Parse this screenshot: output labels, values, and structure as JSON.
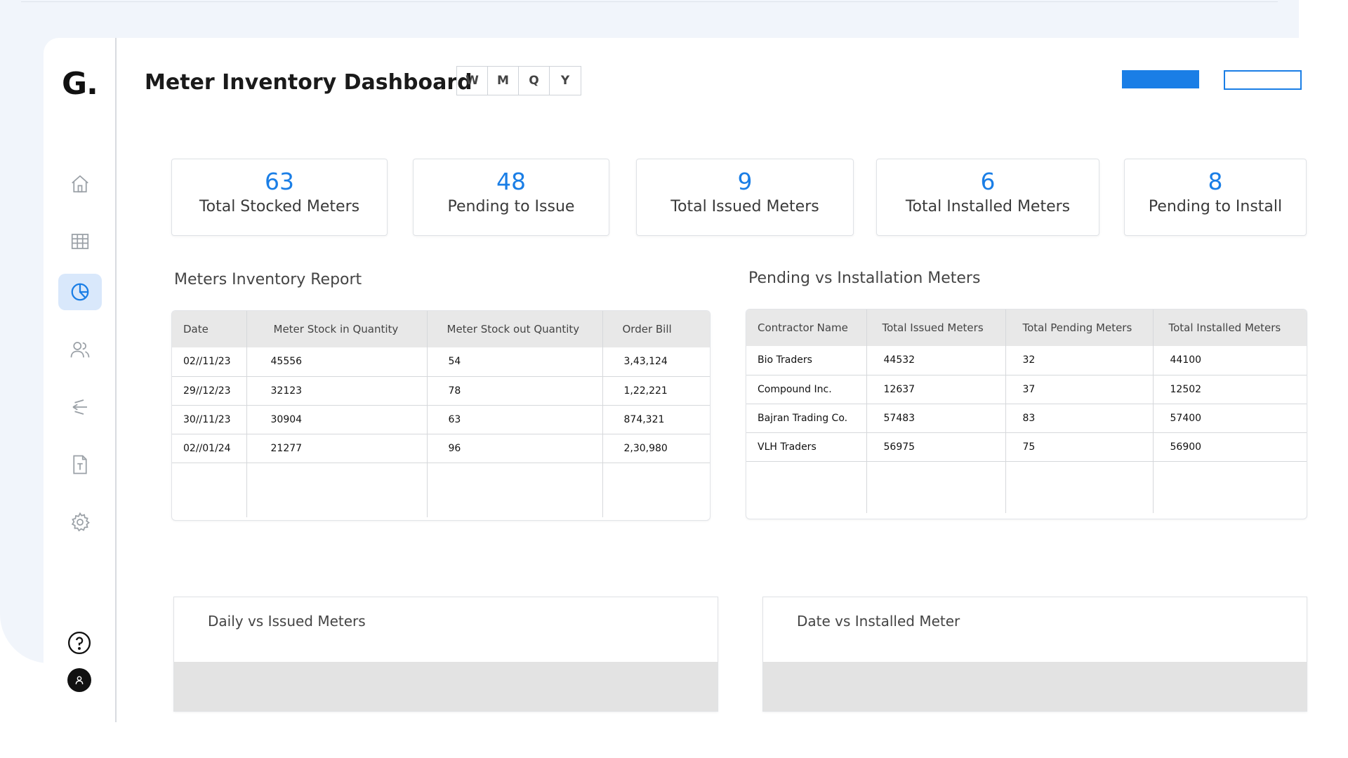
{
  "app": {
    "logo": "G.",
    "title": "Meter Inventory Dashboard"
  },
  "period_tabs": [
    "W",
    "M",
    "Q",
    "Y"
  ],
  "accent_color": "#1a7ee6",
  "sidebar": {
    "items": [
      {
        "icon": "home-icon",
        "active": false
      },
      {
        "icon": "grid-icon",
        "active": false
      },
      {
        "icon": "pie-chart-icon",
        "active": true
      },
      {
        "icon": "users-icon",
        "active": false
      },
      {
        "icon": "transfer-icon",
        "active": false
      },
      {
        "icon": "document-icon",
        "active": false
      },
      {
        "icon": "gear-icon",
        "active": false
      }
    ],
    "bottom": [
      "help-icon",
      "avatar"
    ]
  },
  "kpis": [
    {
      "value": "63",
      "label": "Total Stocked Meters"
    },
    {
      "value": "48",
      "label": "Pending to Issue"
    },
    {
      "value": "9",
      "label": "Total Issued Meters"
    },
    {
      "value": "6",
      "label": "Total Installed Meters"
    },
    {
      "value": "8",
      "label": "Pending to Install"
    }
  ],
  "inventory_report": {
    "title": "Meters Inventory Report",
    "columns": [
      "Date",
      "Meter Stock in Quantity",
      "Meter Stock out Quantity",
      "Order Bill"
    ],
    "rows": [
      [
        "02//11/23",
        "45556",
        "54",
        "3,43,124"
      ],
      [
        "29//12/23",
        "32123",
        "78",
        "1,22,221"
      ],
      [
        "30//11/23",
        "30904",
        "63",
        "874,321"
      ],
      [
        "02//01/24",
        "21277",
        "96",
        "2,30,980"
      ]
    ]
  },
  "pending_installation": {
    "title": "Pending vs Installation Meters",
    "columns": [
      "Contractor Name",
      "Total Issued Meters",
      "Total Pending Meters",
      "Total Installed Meters"
    ],
    "rows": [
      [
        "Bio Traders",
        "44532",
        "32",
        "44100"
      ],
      [
        "Compound Inc.",
        "12637",
        "37",
        "12502"
      ],
      [
        "Bajran Trading Co.",
        "57483",
        "83",
        "57400"
      ],
      [
        "VLH Traders",
        "56975",
        "75",
        "56900"
      ]
    ]
  },
  "charts": [
    {
      "title": "Daily vs Issued Meters"
    },
    {
      "title": "Date vs Installed Meter"
    }
  ]
}
